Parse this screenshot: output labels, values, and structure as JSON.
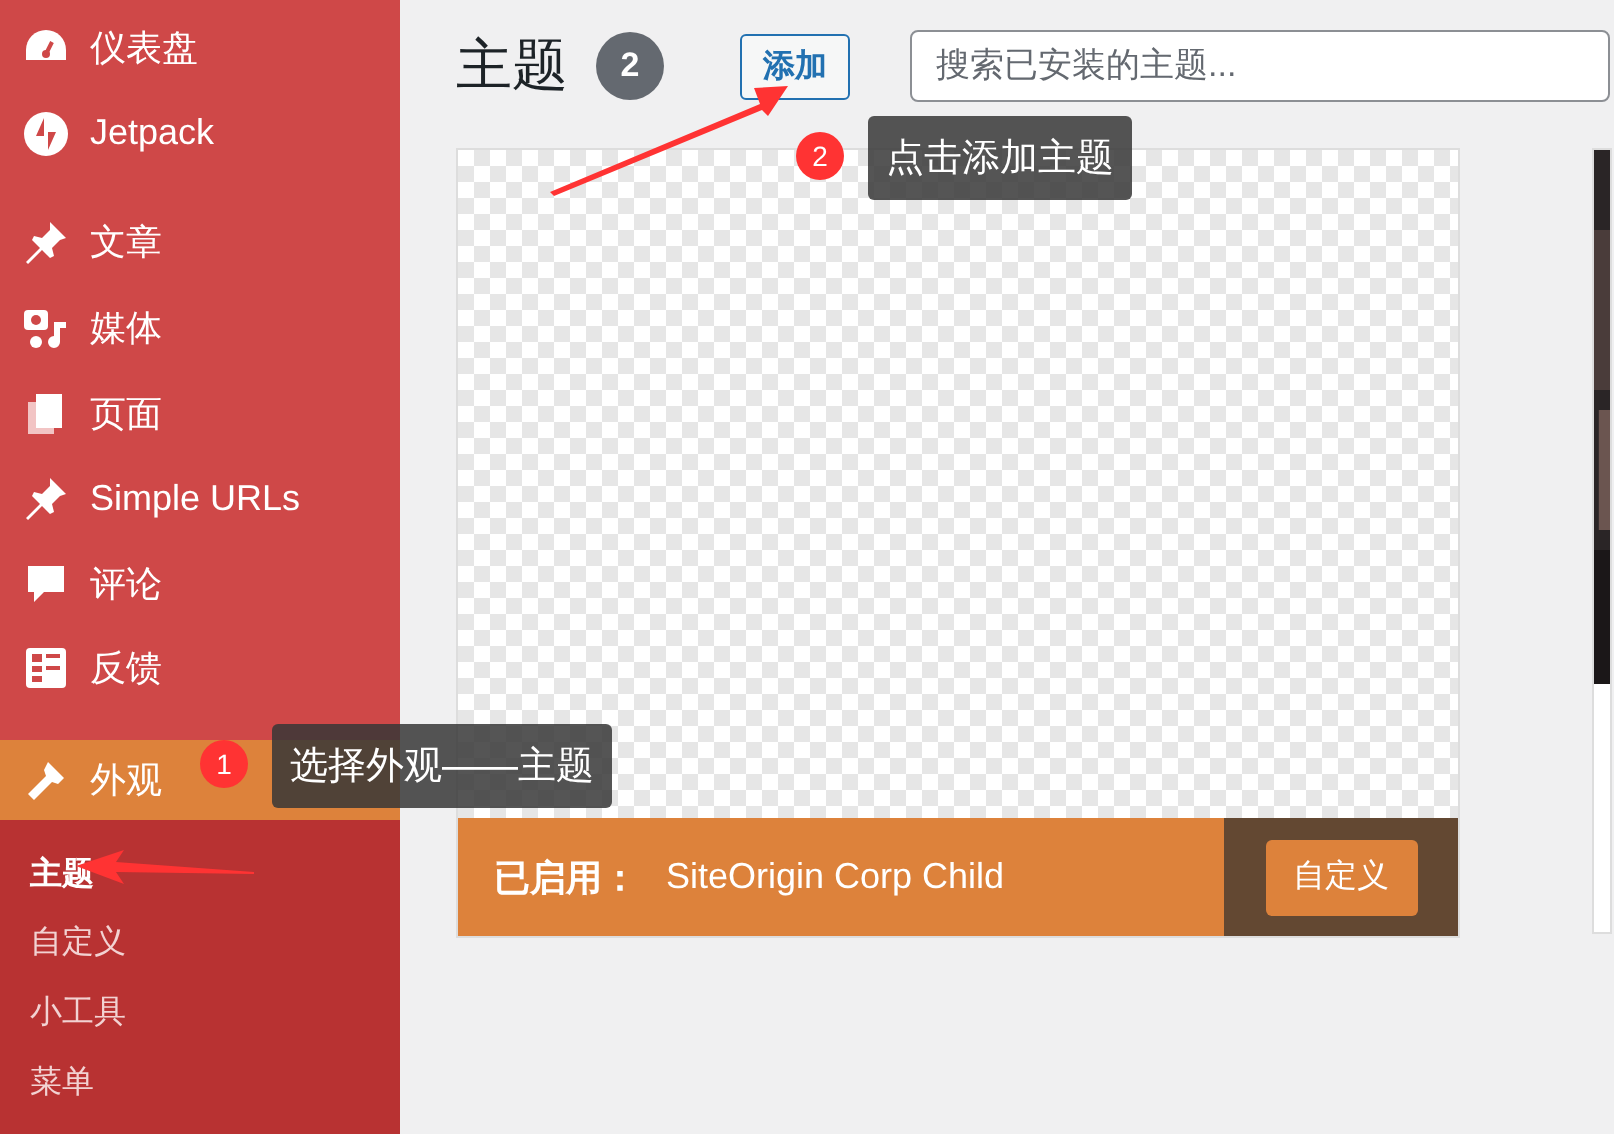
{
  "sidebar": {
    "groups": [
      [
        {
          "label": "仪表盘",
          "selected": false
        },
        {
          "label": "Jetpack",
          "selected": false
        }
      ],
      [
        {
          "label": "文章",
          "selected": false
        },
        {
          "label": "媒体",
          "selected": false
        },
        {
          "label": "页面",
          "selected": false
        },
        {
          "label": "Simple URLs",
          "selected": false
        },
        {
          "label": "评论",
          "selected": false
        },
        {
          "label": "反馈",
          "selected": false
        }
      ],
      [
        {
          "label": "外观",
          "selected": true,
          "children": [
            {
              "label": "主题",
              "selected": true
            },
            {
              "label": "自定义",
              "selected": false
            },
            {
              "label": "小工具",
              "selected": false
            },
            {
              "label": "菜单",
              "selected": false
            }
          ]
        }
      ]
    ]
  },
  "header": {
    "title": "主题",
    "count": "2",
    "add_button": "添加",
    "search": {
      "placeholder": "搜索已安装的主题..."
    }
  },
  "themes": [
    {
      "kind": "active",
      "active_label": "已启用：",
      "name": "SiteOrigin Corp Child",
      "customize_button": "自定义"
    },
    {
      "kind": "picture"
    }
  ],
  "annotations": [
    {
      "number": "1",
      "text": "选择外观——主题"
    },
    {
      "number": "2",
      "text": "点击添加主题"
    }
  ]
}
